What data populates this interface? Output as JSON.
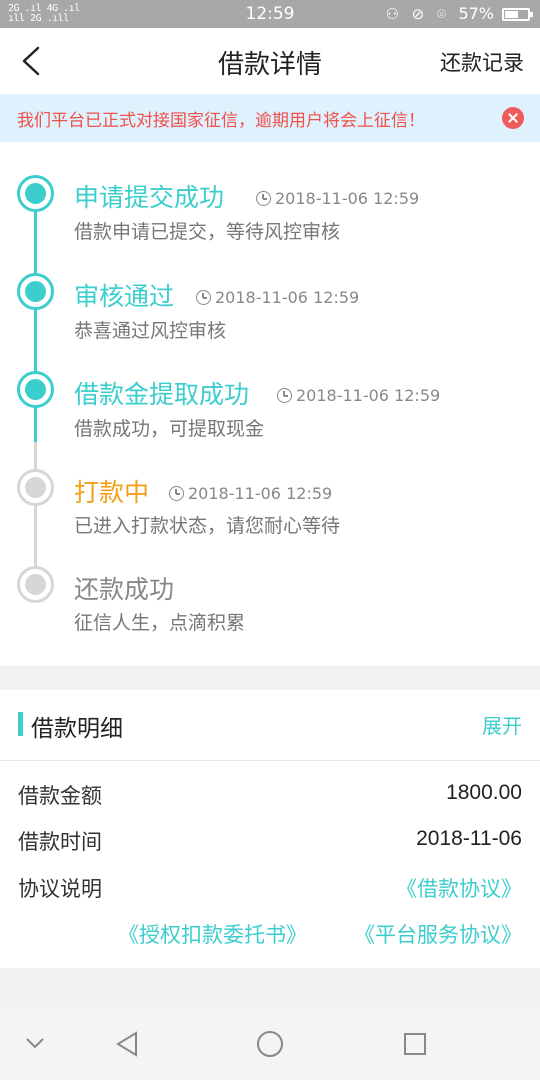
{
  "status_bar": {
    "signal_left_top": "2G .ıl 4G .ıl",
    "signal_left_bottom": "   ıll  2G .ıll",
    "time": "12:59",
    "icons": "⚇ ⊘ ⌾",
    "battery_text": "57%",
    "battery_level": 0.57
  },
  "nav": {
    "title": "借款详情",
    "right_action": "还款记录"
  },
  "notice": {
    "text": "我们平台已正式对接国家征信，逾期用户将会上征信！"
  },
  "timeline": {
    "steps": [
      {
        "title": "申请提交成功",
        "time": "2018-11-06 12:59",
        "desc": "借款申请已提交，等待风控审核",
        "state": "done"
      },
      {
        "title": "审核通过",
        "time": "2018-11-06 12:59",
        "desc": "恭喜通过风控审核",
        "state": "done"
      },
      {
        "title": "借款金提取成功",
        "time": "2018-11-06 12:59",
        "desc": "借款成功，可提取现金",
        "state": "done"
      },
      {
        "title": "打款中",
        "time": "2018-11-06 12:59",
        "desc": "已进入打款状态，请您耐心等待",
        "state": "in-progress"
      },
      {
        "title": "还款成功",
        "time": "",
        "desc": "征信人生，点滴积累",
        "state": "pending"
      }
    ]
  },
  "detail": {
    "title": "借款明细",
    "expand_label": "展开",
    "rows": [
      {
        "label": "借款金额",
        "value": "1800.00"
      },
      {
        "label": "借款时间",
        "value": "2018-11-06"
      },
      {
        "label": "协议说明",
        "value": ""
      }
    ],
    "links": [
      "《借款协议》",
      "《授权扣款委托书》",
      "《平台服务协议》"
    ]
  },
  "colors": {
    "accent": "#3ccdcd",
    "warning": "#f2a019",
    "alert": "#f0504a",
    "notice_bg": "#dff1fc"
  }
}
